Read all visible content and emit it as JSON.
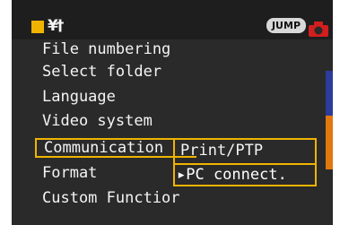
{
  "header": {
    "tool_icon_glyph": "¥†",
    "jump_label": "JUMP",
    "camera_icon": "camera-icon"
  },
  "menu": {
    "items": [
      {
        "label": "File numbering"
      },
      {
        "label": "Select folder"
      },
      {
        "label": "Language"
      },
      {
        "label": "Video system"
      },
      {
        "label": "Communication"
      },
      {
        "label": "Format"
      },
      {
        "label": "Custom Functior"
      }
    ]
  },
  "submenu": {
    "options": [
      "Print/PTP",
      "▸PC connect."
    ],
    "selected": "▸PC connect."
  },
  "colors": {
    "accent": "#f0b400",
    "background": "#2a2a2a",
    "camera_red": "#d21e1e",
    "stripe_blue": "#2c3c9a",
    "stripe_orange": "#e07810"
  }
}
